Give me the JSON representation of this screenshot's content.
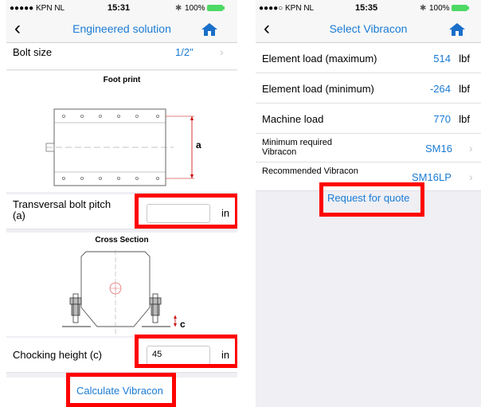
{
  "left": {
    "status": {
      "carrier": "●●●●● KPN NL",
      "time": "15:31",
      "battery": "100%"
    },
    "nav": {
      "title": "Engineered solution"
    },
    "bolt_size": {
      "label": "Bolt size",
      "value": "1/2\""
    },
    "footprint": {
      "title": "Foot print",
      "dim_label": "a"
    },
    "bolt_pitch": {
      "label": "Transversal bolt pitch (a)",
      "value": "",
      "unit": "in"
    },
    "cross_section": {
      "title": "Cross Section",
      "dim_label": "c"
    },
    "chocking": {
      "label": "Chocking height (c)",
      "value": "45",
      "unit": "in"
    },
    "calc_button": "Calculate Vibracon"
  },
  "right": {
    "status": {
      "carrier": "●●●●○ KPN NL",
      "time": "15:35",
      "battery": "100%"
    },
    "nav": {
      "title": "Select Vibracon"
    },
    "rows": [
      {
        "label": "Element load (maximum)",
        "value": "514",
        "unit": "lbf"
      },
      {
        "label": "Element load (minimum)",
        "value": "-264",
        "unit": "lbf"
      },
      {
        "label": "Machine load",
        "value": "770",
        "unit": "lbf"
      }
    ],
    "min_required": {
      "label": "Minimum required Vibracon",
      "value": "SM16"
    },
    "recommended": {
      "label": "Recommended Vibracon",
      "value": "SM16LP"
    },
    "quote_button": "Request for quote"
  },
  "icons": {
    "back": "chevron-left-icon",
    "home": "home-icon",
    "chevron": "chevron-right-icon"
  },
  "colors": {
    "accent": "#1a7bd4",
    "highlight": "#ff0000",
    "battery": "#4cd964",
    "home": "#1a6fc9"
  }
}
